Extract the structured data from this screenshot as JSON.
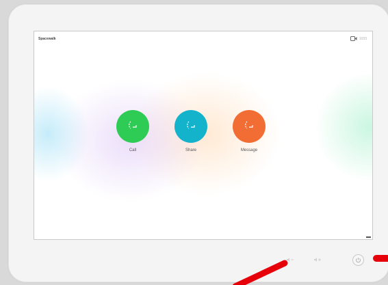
{
  "header": {
    "room_name": "Spacewalk",
    "status_text": "1033"
  },
  "actions": [
    {
      "label": "Call",
      "color": "#2ecc55",
      "icon": "call-icon"
    },
    {
      "label": "Share",
      "color": "#13b3cc",
      "icon": "share-icon"
    },
    {
      "label": "Message",
      "color": "#f26d33",
      "icon": "message-icon"
    }
  ],
  "hardware": {
    "buttons": [
      "volume-down-icon",
      "volume-up-icon",
      "power-icon"
    ]
  },
  "annotation": {
    "color": "#e6000a"
  }
}
